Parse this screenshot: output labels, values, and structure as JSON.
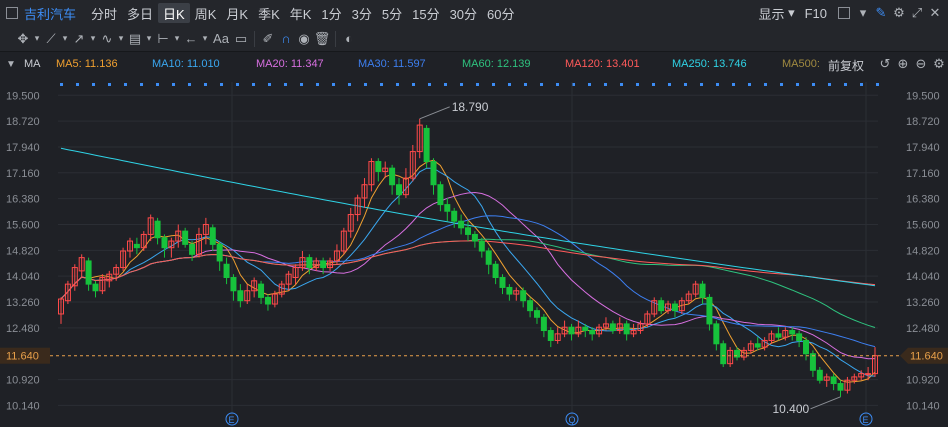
{
  "toolbar": {
    "stock_name": "吉利汽车",
    "periods": [
      "分时",
      "多日",
      "日K",
      "周K",
      "月K",
      "季K",
      "年K",
      "1分",
      "3分",
      "5分",
      "15分",
      "30分",
      "60分"
    ],
    "active_period": "日K",
    "display_label": "显示",
    "f10_label": "F10",
    "font_label": "Aa"
  },
  "ma_bar": {
    "indicator": "MA",
    "items": [
      {
        "label": "MA5: 11.136",
        "color": "#f0a030"
      },
      {
        "label": "MA10: 11.010",
        "color": "#3aa7f0"
      },
      {
        "label": "MA20: 11.347",
        "color": "#d76fe0"
      },
      {
        "label": "MA30: 11.597",
        "color": "#3d7ff0"
      },
      {
        "label": "MA60: 12.139",
        "color": "#2ec27e"
      },
      {
        "label": "MA120: 13.401",
        "color": "#ff5a5a"
      },
      {
        "label": "MA250: 13.746",
        "color": "#2fd3e6"
      },
      {
        "label": "MA500:",
        "color": "#a08a40"
      }
    ],
    "adjust_label": "前复权"
  },
  "chart_data": {
    "type": "candlestick",
    "price_axis": [
      "19.500",
      "18.720",
      "17.940",
      "17.160",
      "16.380",
      "15.600",
      "14.820",
      "14.040",
      "13.260",
      "12.480",
      "11.640",
      "10.920",
      "10.140"
    ],
    "ylim": [
      9.7,
      19.9
    ],
    "current_price": "11.640",
    "high_label": "18.790",
    "low_label": "10.400",
    "event_markers": [
      "E",
      "Q",
      "E"
    ],
    "colors": {
      "up": "#ff4a4a",
      "down": "#17c23c",
      "price_line": "#e8a04a"
    },
    "candles": [
      [
        12.9,
        13.35,
        12.6,
        13.4
      ],
      [
        13.3,
        13.8,
        13.2,
        13.9
      ],
      [
        13.75,
        14.3,
        13.6,
        14.4
      ],
      [
        14.2,
        14.6,
        14.0,
        14.7
      ],
      [
        14.5,
        13.8,
        13.6,
        14.6
      ],
      [
        13.8,
        13.6,
        13.4,
        13.9
      ],
      [
        13.6,
        14.0,
        13.5,
        14.1
      ],
      [
        13.9,
        14.1,
        13.7,
        14.2
      ],
      [
        14.1,
        14.3,
        13.9,
        14.4
      ],
      [
        14.3,
        14.8,
        14.2,
        14.9
      ],
      [
        14.8,
        15.1,
        14.6,
        15.2
      ],
      [
        15.0,
        14.9,
        14.7,
        15.2
      ],
      [
        14.9,
        15.3,
        14.8,
        15.4
      ],
      [
        15.3,
        15.8,
        15.1,
        15.9
      ],
      [
        15.7,
        15.2,
        15.0,
        15.8
      ],
      [
        15.2,
        14.9,
        14.6,
        15.3
      ],
      [
        14.9,
        15.1,
        14.6,
        15.2
      ],
      [
        15.1,
        15.4,
        14.9,
        15.6
      ],
      [
        15.4,
        15.0,
        14.9,
        15.5
      ],
      [
        15.0,
        14.7,
        14.5,
        15.1
      ],
      [
        14.7,
        15.3,
        14.6,
        15.5
      ],
      [
        15.3,
        15.6,
        15.0,
        15.8
      ],
      [
        15.5,
        15.0,
        14.8,
        15.6
      ],
      [
        15.0,
        14.5,
        14.2,
        15.1
      ],
      [
        14.4,
        14.0,
        13.8,
        14.6
      ],
      [
        14.0,
        13.6,
        13.3,
        14.1
      ],
      [
        13.6,
        13.3,
        13.1,
        13.8
      ],
      [
        13.3,
        13.6,
        13.2,
        13.8
      ],
      [
        13.6,
        13.9,
        13.4,
        14.0
      ],
      [
        13.8,
        13.4,
        13.2,
        13.9
      ],
      [
        13.4,
        13.2,
        13.0,
        13.5
      ],
      [
        13.2,
        13.5,
        13.1,
        13.6
      ],
      [
        13.5,
        13.8,
        13.4,
        13.9
      ],
      [
        13.8,
        14.1,
        13.6,
        14.2
      ],
      [
        14.0,
        14.3,
        13.8,
        14.4
      ],
      [
        14.3,
        14.6,
        14.2,
        14.8
      ],
      [
        14.6,
        14.3,
        14.1,
        14.7
      ],
      [
        14.3,
        14.5,
        14.2,
        14.6
      ],
      [
        14.5,
        14.3,
        14.1,
        14.6
      ],
      [
        14.3,
        14.5,
        14.2,
        14.6
      ],
      [
        14.5,
        14.8,
        14.4,
        15.0
      ],
      [
        14.8,
        15.4,
        14.7,
        15.5
      ],
      [
        15.4,
        15.9,
        15.2,
        16.1
      ],
      [
        15.9,
        16.4,
        15.7,
        16.5
      ],
      [
        16.4,
        16.8,
        16.1,
        17.0
      ],
      [
        16.8,
        17.5,
        16.6,
        17.6
      ],
      [
        17.5,
        17.2,
        16.9,
        17.6
      ],
      [
        17.2,
        17.3,
        17.0,
        17.5
      ],
      [
        17.3,
        16.8,
        16.5,
        17.4
      ],
      [
        16.8,
        16.5,
        16.2,
        17.0
      ],
      [
        16.5,
        17.0,
        16.4,
        17.3
      ],
      [
        17.0,
        17.8,
        16.9,
        18.0
      ],
      [
        17.8,
        18.6,
        17.6,
        18.79
      ],
      [
        18.5,
        17.5,
        17.3,
        18.6
      ],
      [
        17.5,
        16.8,
        16.5,
        17.6
      ],
      [
        16.8,
        16.2,
        16.0,
        16.9
      ],
      [
        16.2,
        16.0,
        15.7,
        16.4
      ],
      [
        16.0,
        15.7,
        15.5,
        16.1
      ],
      [
        15.7,
        15.5,
        15.3,
        15.9
      ],
      [
        15.5,
        15.3,
        15.1,
        15.7
      ],
      [
        15.3,
        15.1,
        14.9,
        15.4
      ],
      [
        15.1,
        14.8,
        14.6,
        15.2
      ],
      [
        14.8,
        14.4,
        14.1,
        14.9
      ],
      [
        14.4,
        14.0,
        13.8,
        14.5
      ],
      [
        14.0,
        13.7,
        13.5,
        14.1
      ],
      [
        13.7,
        13.5,
        13.3,
        13.8
      ],
      [
        13.5,
        13.6,
        13.3,
        13.7
      ],
      [
        13.6,
        13.3,
        13.1,
        13.7
      ],
      [
        13.3,
        13.0,
        12.8,
        13.4
      ],
      [
        13.0,
        12.8,
        12.6,
        13.1
      ],
      [
        12.8,
        12.4,
        12.2,
        12.9
      ],
      [
        12.4,
        12.1,
        11.9,
        12.5
      ],
      [
        12.1,
        12.3,
        12.0,
        12.5
      ],
      [
        12.3,
        12.5,
        12.2,
        12.7
      ],
      [
        12.5,
        12.3,
        12.1,
        12.6
      ],
      [
        12.3,
        12.5,
        12.2,
        12.7
      ],
      [
        12.5,
        12.4,
        12.2,
        12.6
      ],
      [
        12.4,
        12.3,
        12.1,
        12.5
      ],
      [
        12.3,
        12.5,
        12.2,
        12.6
      ],
      [
        12.5,
        12.6,
        12.4,
        12.8
      ],
      [
        12.6,
        12.4,
        12.3,
        12.7
      ],
      [
        12.4,
        12.6,
        12.3,
        12.8
      ],
      [
        12.6,
        12.3,
        12.1,
        12.7
      ],
      [
        12.3,
        12.4,
        12.2,
        12.6
      ],
      [
        12.4,
        12.6,
        12.3,
        12.7
      ],
      [
        12.6,
        12.9,
        12.5,
        13.0
      ],
      [
        12.9,
        13.3,
        12.8,
        13.4
      ],
      [
        13.3,
        13.0,
        12.9,
        13.4
      ],
      [
        13.0,
        13.2,
        12.9,
        13.3
      ],
      [
        13.2,
        13.0,
        12.8,
        13.3
      ],
      [
        13.0,
        13.3,
        12.9,
        13.4
      ],
      [
        13.3,
        13.5,
        13.2,
        13.6
      ],
      [
        13.5,
        13.8,
        13.4,
        13.9
      ],
      [
        13.8,
        13.4,
        13.2,
        13.9
      ],
      [
        13.4,
        12.6,
        12.4,
        13.5
      ],
      [
        12.6,
        12.0,
        11.8,
        12.7
      ],
      [
        12.0,
        11.4,
        11.3,
        12.1
      ],
      [
        11.4,
        11.8,
        11.3,
        11.9
      ],
      [
        11.8,
        11.6,
        11.5,
        11.9
      ],
      [
        11.6,
        11.8,
        11.5,
        11.9
      ],
      [
        11.8,
        12.0,
        11.7,
        12.1
      ],
      [
        12.0,
        11.9,
        11.8,
        12.2
      ],
      [
        11.9,
        12.1,
        11.8,
        12.2
      ],
      [
        12.1,
        12.3,
        12.0,
        12.4
      ],
      [
        12.3,
        12.2,
        12.1,
        12.5
      ],
      [
        12.2,
        12.4,
        12.1,
        12.5
      ],
      [
        12.4,
        12.3,
        12.1,
        12.5
      ],
      [
        12.3,
        12.1,
        11.9,
        12.4
      ],
      [
        12.1,
        11.7,
        11.5,
        12.2
      ],
      [
        11.7,
        11.2,
        11.0,
        11.8
      ],
      [
        11.2,
        10.9,
        10.8,
        11.3
      ],
      [
        10.9,
        11.0,
        10.7,
        11.1
      ],
      [
        11.0,
        10.8,
        10.6,
        11.1
      ],
      [
        10.8,
        10.6,
        10.4,
        10.9
      ],
      [
        10.6,
        10.9,
        10.5,
        11.0
      ],
      [
        10.9,
        11.0,
        10.8,
        11.1
      ],
      [
        11.0,
        11.1,
        10.9,
        11.2
      ],
      [
        11.1,
        11.1,
        10.9,
        11.3
      ],
      [
        11.1,
        11.64,
        11.0,
        11.9
      ]
    ]
  }
}
